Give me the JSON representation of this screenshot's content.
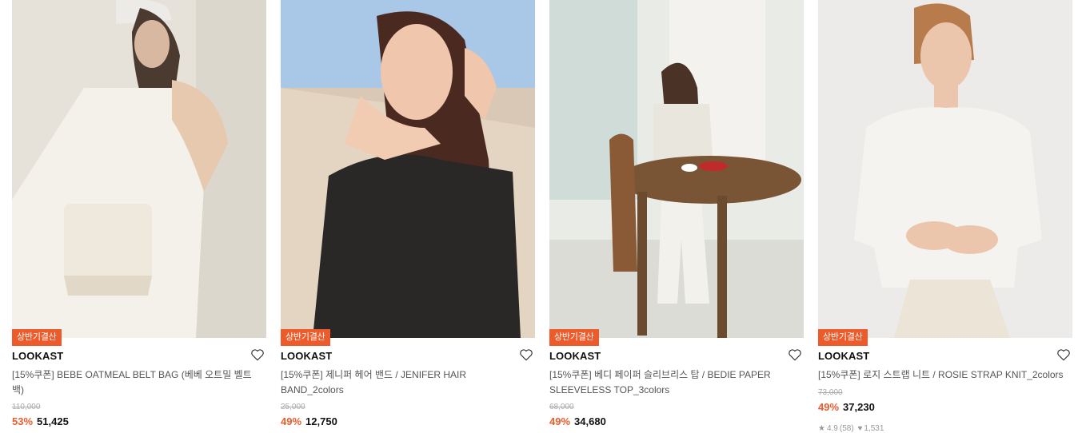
{
  "products": [
    {
      "badge": "상반기결산",
      "brand": "LOOKAST",
      "name": "[15%쿠폰] BEBE OATMEAL BELT BAG (베베 오트밀 벨트백)",
      "original_price": "110,000",
      "discount": "53%",
      "price": "51,425"
    },
    {
      "badge": "상반기결산",
      "brand": "LOOKAST",
      "name": "[15%쿠폰] 제니퍼 헤어 밴드 / JENIFER HAIR BAND_2colors",
      "original_price": "25,000",
      "discount": "49%",
      "price": "12,750"
    },
    {
      "badge": "상반기결산",
      "brand": "LOOKAST",
      "name": "[15%쿠폰] 베디 페이퍼 슬리브리스 탑 / BEDIE PAPER SLEEVELESS TOP_3colors",
      "original_price": "68,000",
      "discount": "49%",
      "price": "34,680"
    },
    {
      "badge": "상반기결산",
      "brand": "LOOKAST",
      "name": "[15%쿠폰] 로지 스트랩 니트 / ROSIE STRAP KNIT_2colors",
      "original_price": "73,000",
      "discount": "49%",
      "price": "37,230",
      "rating": "4.9",
      "reviews": "(58)",
      "likes": "1,531"
    }
  ],
  "icons": {
    "wishlist": "heart-outline-icon",
    "rating": "star-icon",
    "likes": "heart-filled-icon"
  },
  "colors": {
    "accent": "#ee5b2b",
    "text": "#222222",
    "muted": "#999999"
  }
}
